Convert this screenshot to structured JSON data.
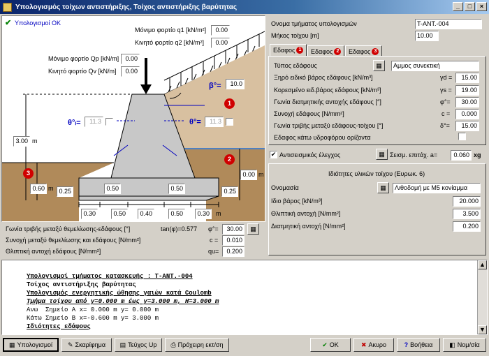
{
  "window": {
    "title": "Υπολογισμός τοίχων αντιστήριξης, Τοίχος αντιστήριξης βαρύτητας",
    "minimize": "_",
    "maximize": "□",
    "close": "×"
  },
  "drawing": {
    "status": "Υπολογισμοί ΟΚ",
    "q1_label": "Μόνιμο φορτίο q1 [kN/m²]",
    "q1_value": "0.00",
    "q2_label": "Κινητό φορτίο q2 [kN/m²]",
    "q2_value": "0.00",
    "qp_label": "Μόνιμο φορτίο Qp [kN/m]",
    "qp_value": "0.00",
    "qv_label": "Κινητό φορτίο Qv [kN/m]",
    "qv_value": "0.00",
    "beta_label": "β°=",
    "beta_value": "10.0",
    "theta_l_label": "θ°ₗ=",
    "theta_l_value": "11.3",
    "theta_r_label": "θ°=",
    "theta_r_value": "11.3",
    "height_value": "3.00",
    "height_unit": "m",
    "right_depth_value": "0.00",
    "right_depth_unit": "m",
    "left_depth_value": "0.60",
    "left_depth_unit": "m",
    "left_toe_h": "0.25",
    "right_toe_h": "0.25",
    "inner_left_h": "0.50",
    "inner_right_h": "0.50",
    "dims": [
      "0.30",
      "0.50",
      "0.40",
      "0.50",
      "0.30"
    ],
    "dims_unit": "m",
    "badge1": "1",
    "badge2": "2",
    "badge3": "3"
  },
  "foundation": {
    "friction_label": "Γωνία τριβής μεταξύ θεμελίωσης-εδάφους [°]",
    "tan_text": "tan(φ)=0.577",
    "phi_label": "φ°=",
    "phi_value": "30.00",
    "cohesion_label": "Συνοχή μεταξύ θεμελίωσης και εδάφους [N/mm²]",
    "c_label": "c =",
    "c_value": "0.010",
    "bearing_label": "Θλιπτική αντοχή εδάφους [N/mm²]",
    "qu_label": "qu=",
    "qu_value": "0.200"
  },
  "section": {
    "name_label": "Ονομα τμήματος υπολογισμών",
    "name_value": "T-ANT.-004",
    "length_label": "Μήκος τοίχου [m]",
    "length_value": "10.00"
  },
  "tabs": [
    {
      "label": "Εδαφος",
      "n": "1"
    },
    {
      "label": "Εδαφος",
      "n": "2"
    },
    {
      "label": "Εδαφος",
      "n": "3"
    }
  ],
  "soil": {
    "type_label": "Τύπος εδάφους",
    "type_value": "Αμμος συνεκτική",
    "dry_label": "Ξηρό ειδικό βάρος εδάφους [kN/m³]",
    "dry_sym": "γd =",
    "dry_value": "15.00",
    "sat_label": "Κορεσμένο ειδ.βάρος εδάφους [kN/m³]",
    "sat_sym": "γs =",
    "sat_value": "19.00",
    "phi_label": "Γωνία διατμητικής αντοχής εδάφους [°]",
    "phi_sym": "φ°=",
    "phi_value": "30.00",
    "c_label": "Συνοχή εδάφους [N/mm²]",
    "c_sym": "c =",
    "c_value": "0.000",
    "delta_label": "Γωνία τριβής μεταξύ εδάφους-τοίχου [°]",
    "delta_sym": "δ°=",
    "delta_value": "15.00",
    "water_label": "Εδαφος κάτω υδροφόρου ορίζοντα"
  },
  "seismic": {
    "label": "Αντισεισμικός έλεγχος",
    "accel_label": "Σεισμ. επιτάχ. a=",
    "accel_value": "0.060",
    "accel_unit": "xg"
  },
  "material": {
    "header": "Ιδιότητες υλικών τοίχου (Ευρωκ. 6)",
    "name_label": "Ονομασία",
    "name_value": "Λιθοδομή με Μ5 κονίαμμα",
    "weight_label": "Ιδιο βάρος [kN/m³]",
    "weight_value": "20.000",
    "comp_label": "Θλιπτική αντοχή [N/mm²]",
    "comp_value": "3.500",
    "shear_label": "Διατμητική αντοχή [N/mm²]",
    "shear_value": "0.200"
  },
  "report": [
    "Υπολογισμοί τμήματος κατασκευής : T-ANT.-004",
    "Τοίχος αντιστήριξης βαρύτητας",
    "Υπολογισμός ενεργητικής ώθησης γαιών κατά Coulomb",
    "Τμήμα τοίχου από y=0.000 m έως y=3.000 m, H=3.000 m",
    "Ανω  Σημείο A x= 0.000 m y= 0.000 m",
    "Κάτω Σημείο B x=-0.600 m y= 3.000 m",
    "Ιδιότητες εδάφους"
  ],
  "buttons": {
    "calc": "Υπολογισμοί",
    "sketch": "Σκαρίφημα",
    "up": "Τεύχος Up",
    "draft": "Πρόχειρη εκτ/ση",
    "ok": "OK",
    "cancel": "Ακυρο",
    "help": "Βοήθεια",
    "nav": "Νομ/σία"
  },
  "colors": {
    "soil": "#b08a5a",
    "wall": "#c8c8c8",
    "water": "#5080c0",
    "accent": "#d00000"
  }
}
